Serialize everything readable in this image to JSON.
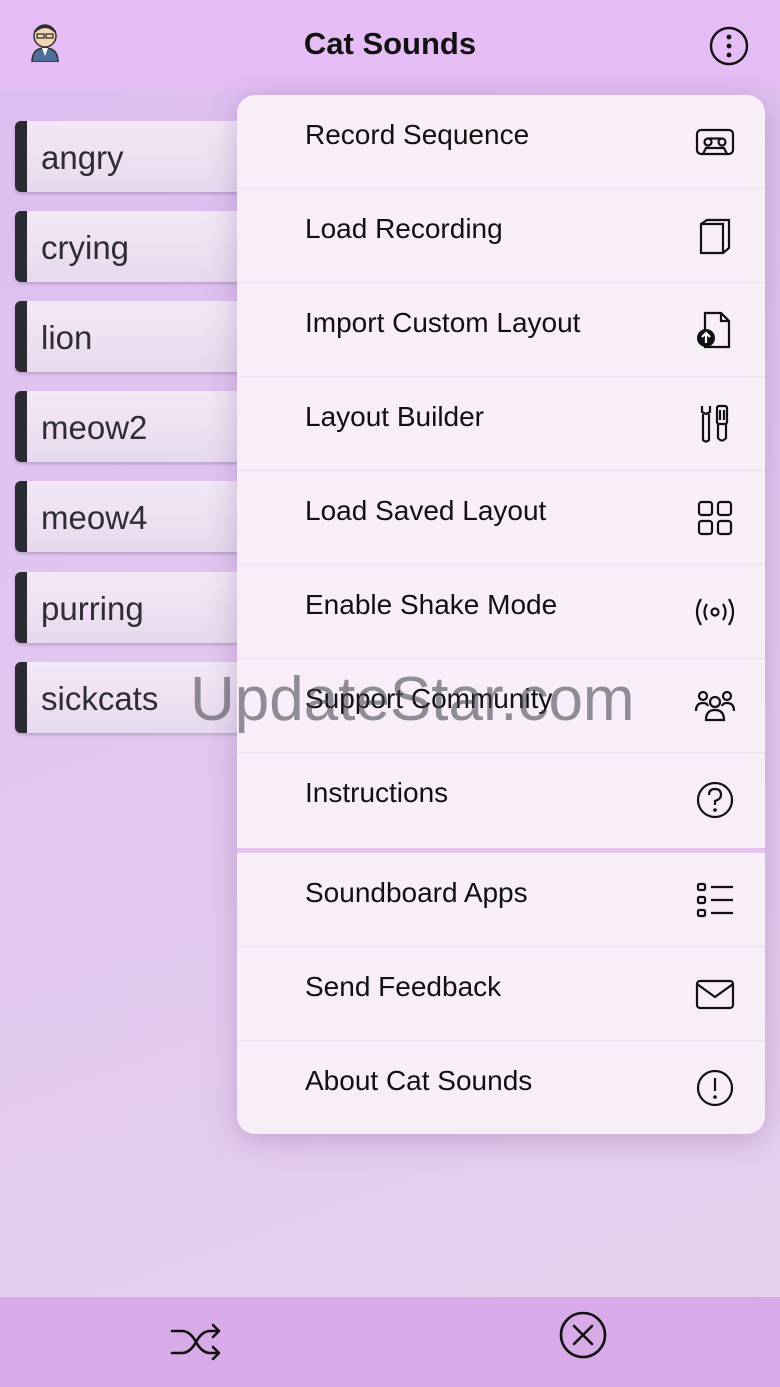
{
  "header": {
    "title": "Cat Sounds",
    "avatar_icon": "person-avatar-icon",
    "more_icon": "more-vertical-circle-icon"
  },
  "sounds": [
    "angry",
    "crying",
    "lion",
    "meow2",
    "meow4",
    "purring",
    "sickcats"
  ],
  "menu": {
    "items": [
      {
        "label": "Record Sequence",
        "icon": "cassette-icon"
      },
      {
        "label": "Load Recording",
        "icon": "folder-icon"
      },
      {
        "label": "Import Custom Layout",
        "icon": "file-upload-icon"
      },
      {
        "label": "Layout Builder",
        "icon": "tools-icon"
      },
      {
        "label": "Load Saved Layout",
        "icon": "grid-icon"
      },
      {
        "label": "Enable Shake Mode",
        "icon": "broadcast-icon"
      },
      {
        "label": "Support Community",
        "icon": "community-icon"
      },
      {
        "label": "Instructions",
        "icon": "question-circle-icon"
      }
    ],
    "secondary_items": [
      {
        "label": "Soundboard Apps",
        "icon": "list-icon"
      },
      {
        "label": "Send Feedback",
        "icon": "envelope-icon"
      },
      {
        "label": "About Cat Sounds",
        "icon": "info-circle-icon"
      }
    ]
  },
  "watermark": "UpdateStar.com",
  "footer": {
    "shuffle_icon": "shuffle-icon",
    "stop_icon": "close-circle-icon"
  },
  "colors": {
    "header_bg": "#e5bcf3",
    "footer_bg": "#d8abe8",
    "menu_bg": "#f7eef8",
    "button_edge": "#2b2b33"
  }
}
